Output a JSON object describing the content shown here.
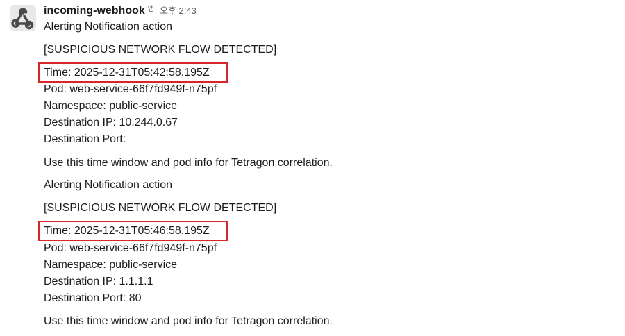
{
  "message": {
    "sender": "incoming-webhook",
    "app_badge": "앱",
    "timestamp": "오후 2:43",
    "avatar_icon": "webhook-icon",
    "highlight_color": "#d7262b"
  },
  "alerts": [
    {
      "heading": "Alerting Notification action",
      "tag": "[SUSPICIOUS NETWORK FLOW DETECTED]",
      "time": "Time: 2025-12-31T05:42:58.195Z",
      "pod": "Pod: web-service-66f7fd949f-n75pf",
      "namespace": "Namespace: public-service",
      "dest_ip": "Destination IP: 10.244.0.67",
      "dest_port": "Destination Port:",
      "footer": "Use this time window and pod info for Tetragon correlation."
    },
    {
      "heading": "Alerting Notification action",
      "tag": "[SUSPICIOUS NETWORK FLOW DETECTED]",
      "time": "Time: 2025-12-31T05:46:58.195Z",
      "pod": "Pod: web-service-66f7fd949f-n75pf",
      "namespace": "Namespace: public-service",
      "dest_ip": "Destination IP: 1.1.1.1",
      "dest_port": "Destination Port: 80",
      "footer": "Use this time window and pod info for Tetragon correlation."
    }
  ]
}
